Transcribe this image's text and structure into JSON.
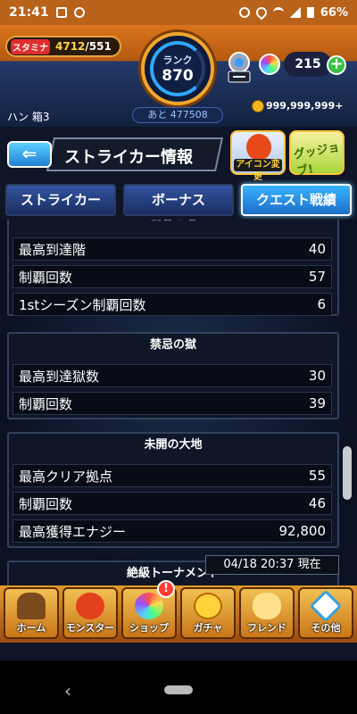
{
  "statusbar": {
    "time": "21:41",
    "battery": "66%"
  },
  "header": {
    "stamina_label": "スタミナ",
    "stamina_value": "4712",
    "stamina_max": "/551",
    "rank_label": "ランク",
    "rank_value": "870",
    "next_exp": "あと 477508",
    "orb_count": "215",
    "plus": "+",
    "username": "ハン 箱3",
    "coins": "999,999,999+"
  },
  "titlebar": {
    "back": "⇐",
    "title": "ストライカー情報",
    "icon_btn": "アイコン変更",
    "goods_btn": "グッジョブ!"
  },
  "tabs": [
    {
      "label": "ストライカー"
    },
    {
      "label": "ボーナス"
    },
    {
      "label": "クエスト戦績"
    }
  ],
  "sections": {
    "s1": {
      "header": "覇者の塔",
      "rows": [
        {
          "label": "最高到達階",
          "value": "40"
        },
        {
          "label": "制覇回数",
          "value": "57"
        },
        {
          "label": "1stシーズン制覇回数",
          "value": "6"
        }
      ]
    },
    "s2": {
      "header": "禁忌の獄",
      "rows": [
        {
          "label": "最高到達獄数",
          "value": "30"
        },
        {
          "label": "制覇回数",
          "value": "39"
        }
      ]
    },
    "s3": {
      "header": "未開の大地",
      "rows": [
        {
          "label": "最高クリア拠点",
          "value": "55"
        },
        {
          "label": "制覇回数",
          "value": "46"
        },
        {
          "label": "最高獲得エナジー",
          "value": "92,800"
        }
      ]
    },
    "s4": {
      "header": "絶級トーナメント"
    }
  },
  "timestamp": "04/18 20:37 現在",
  "nav": [
    {
      "label": "ホーム",
      "icon": "home-icon"
    },
    {
      "label": "モンスター",
      "icon": "monster-icon"
    },
    {
      "label": "ショップ",
      "icon": "shop-orb-icon"
    },
    {
      "label": "ガチャ",
      "icon": "gacha-icon"
    },
    {
      "label": "フレンド",
      "icon": "friend-icon"
    },
    {
      "label": "その他",
      "icon": "other-icon"
    }
  ],
  "nav_badge": "!",
  "android_nav": {
    "back": "‹"
  }
}
